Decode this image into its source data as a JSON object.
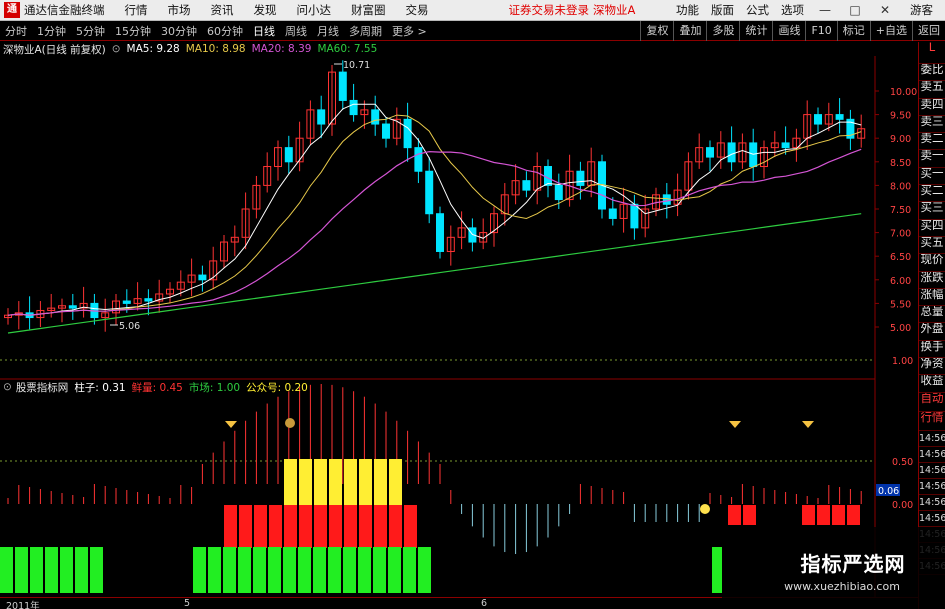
{
  "titlebar": {
    "app_name": "通达信金融终端",
    "menus": [
      "行情",
      "市场",
      "资讯",
      "发现",
      "问小达",
      "财富圈",
      "交易"
    ],
    "notice": "证券交易未登录",
    "stock_name": "深物业A",
    "right_menus": [
      "功能",
      "版面",
      "公式",
      "选项"
    ],
    "login": "游客",
    "minimize": "—",
    "maximize": "□",
    "close": "✕"
  },
  "toolbar": {
    "periods": [
      "分时",
      "1分钟",
      "5分钟",
      "15分钟",
      "30分钟",
      "60分钟",
      "日线",
      "周线",
      "月线",
      "多周期",
      "更多 >"
    ],
    "active_period": "日线",
    "right_buttons": [
      "复权",
      "叠加",
      "多股",
      "统计",
      "画线",
      "F10",
      "标记",
      "+自选",
      "返回"
    ]
  },
  "main_info": {
    "stock": "深物业A(日线 前复权)",
    "ma5": "MA5: 9.28",
    "ma10": "MA10: 8.98",
    "ma20": "MA20: 8.39",
    "ma60": "MA60: 7.55",
    "ma5_color": "#ffffff",
    "ma10_color": "#e6c84a",
    "ma20_color": "#d455d4",
    "ma60_color": "#2ecc40"
  },
  "price_axis": [
    "10.00",
    "9.50",
    "9.00",
    "8.50",
    "8.00",
    "7.50",
    "7.00",
    "6.50",
    "6.00",
    "5.50",
    "5.00"
  ],
  "annotations": {
    "high": "10.71",
    "low": "5.06"
  },
  "indicator_info": {
    "name": "股票指标网",
    "col": "柱子: 0.31",
    "heat": "鲜量: 0.45",
    "market": "市场: 1.00",
    "public": "公众号: 0.20"
  },
  "indicator_axis": [
    "1.00",
    "0.50",
    "0.00"
  ],
  "indicator_current": "0.06",
  "side_panel": {
    "items": [
      "委比",
      "卖五",
      "卖四",
      "卖三",
      "卖二",
      "卖一",
      "买一",
      "买二",
      "买三",
      "买四",
      "买五",
      "现价",
      "涨跌",
      "涨幅",
      "总量",
      "外盘",
      "换手",
      "净资",
      "收益",
      "自动",
      "行情"
    ],
    "times": [
      "14:56",
      "14:56",
      "14:56",
      "14:56",
      "14:56",
      "14:56",
      "14:56",
      "14:56",
      "14:56"
    ],
    "top": "L"
  },
  "bottom_axis": {
    "year": "2011年",
    "m5": "5",
    "m6": "6"
  },
  "watermark": {
    "title": "指标严选网",
    "url": "www.xuezhibiao.com"
  },
  "colors": {
    "up": "#ff3333",
    "down": "#00e5ff",
    "yellow": "#ffee33",
    "red_bar": "#ff1a1a",
    "green_bar": "#22ee22",
    "grid": "#8b0000"
  }
}
